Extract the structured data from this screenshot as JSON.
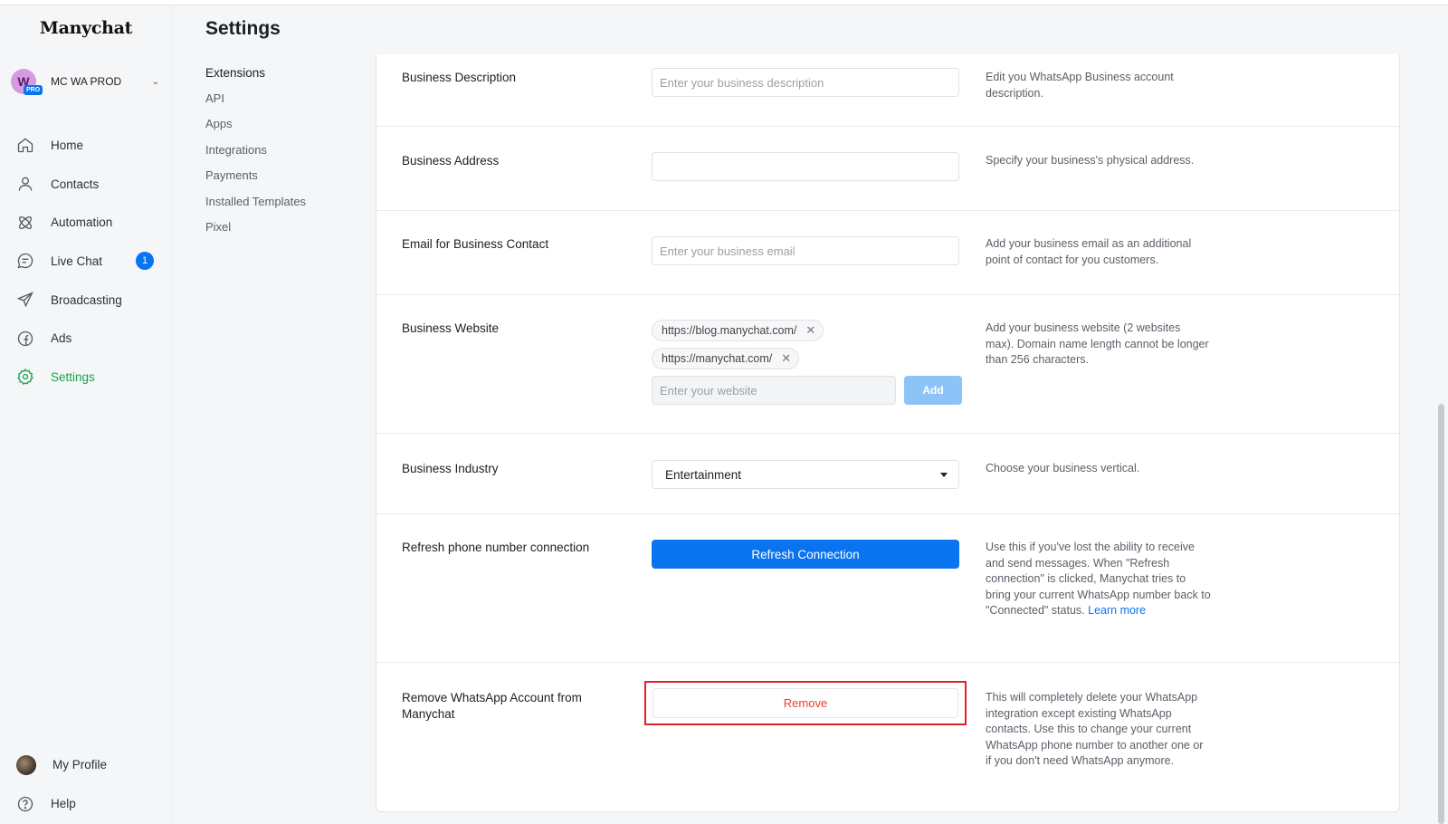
{
  "app": {
    "logo": "Manychat",
    "account": {
      "initial": "W",
      "badge": "PRO",
      "name": "MC WA PROD"
    }
  },
  "sidebar": {
    "items": [
      {
        "label": "Home",
        "icon": "home-icon"
      },
      {
        "label": "Contacts",
        "icon": "user-icon"
      },
      {
        "label": "Automation",
        "icon": "automation-icon"
      },
      {
        "label": "Live Chat",
        "icon": "chat-icon",
        "badge": "1"
      },
      {
        "label": "Broadcasting",
        "icon": "send-icon"
      },
      {
        "label": "Ads",
        "icon": "facebook-icon"
      },
      {
        "label": "Settings",
        "icon": "gear-icon",
        "active": true
      }
    ],
    "bottom": [
      {
        "label": "My Profile",
        "icon": "profile-avatar"
      },
      {
        "label": "Help",
        "icon": "help-icon"
      }
    ]
  },
  "header": {
    "title": "Settings"
  },
  "subnav": {
    "heading": "Extensions",
    "items": [
      "API",
      "Apps",
      "Integrations",
      "Payments",
      "Installed Templates",
      "Pixel"
    ]
  },
  "form": {
    "description": {
      "label": "Business Description",
      "placeholder": "Enter your business description",
      "help": "Edit you WhatsApp Business account description."
    },
    "address": {
      "label": "Business Address",
      "placeholder": "",
      "help": "Specify your business's physical address."
    },
    "email": {
      "label": "Email for Business Contact",
      "placeholder": "Enter your business email",
      "help": "Add your business email as an additional point of contact for you customers."
    },
    "website": {
      "label": "Business Website",
      "chips": [
        "https://blog.manychat.com/",
        "https://manychat.com/"
      ],
      "chip_remove": "✕",
      "placeholder": "Enter your website",
      "add_label": "Add",
      "help": "Add your business website (2 websites max). Domain name length cannot be longer than 256 characters."
    },
    "industry": {
      "label": "Business Industry",
      "value": "Entertainment",
      "help": "Choose your business vertical."
    },
    "refresh": {
      "label": "Refresh phone number connection",
      "button": "Refresh Connection",
      "help": "Use this if you've lost the ability to receive and send messages. When \"Refresh connection\" is clicked, Manychat tries to bring your current WhatsApp number back to \"Connected\" status.",
      "link": "Learn more"
    },
    "remove": {
      "label": "Remove WhatsApp Account from Manychat",
      "button": "Remove",
      "help": "This will completely delete your WhatsApp integration except existing WhatsApp contacts. Use this to change your current WhatsApp phone number to another one or if you don't need WhatsApp anymore."
    }
  },
  "colors": {
    "accent": "#0a74f0",
    "active": "#17a34a",
    "danger": "#e5412e",
    "highlight": "#e0242b"
  }
}
